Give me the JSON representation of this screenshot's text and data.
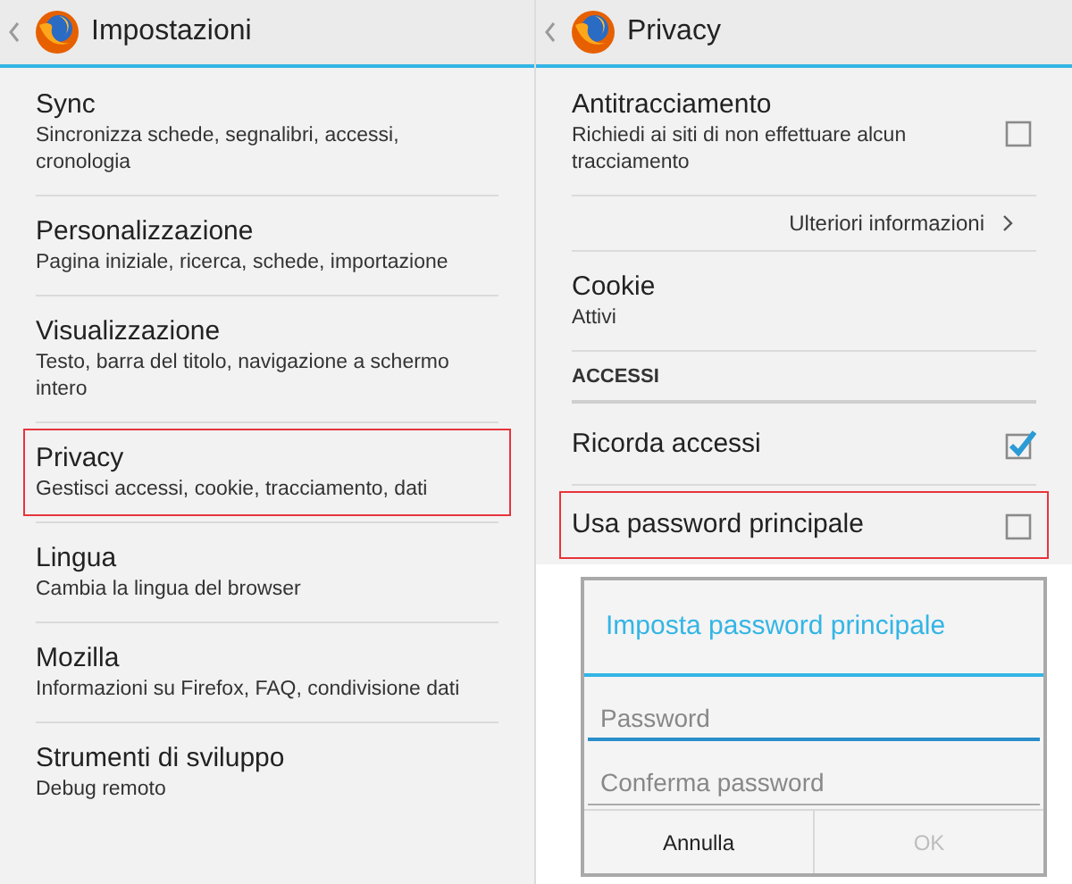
{
  "panels": [
    {
      "title": "Impostazioni",
      "items": [
        {
          "kind": "entry",
          "title": "Sync",
          "subtitle": "Sincronizza schede, segnalibri, accessi, cronologia",
          "highlighted": false
        },
        {
          "kind": "entry",
          "title": "Personalizzazione",
          "subtitle": "Pagina iniziale, ricerca, schede, importazione",
          "highlighted": false
        },
        {
          "kind": "entry",
          "title": "Visualizzazione",
          "subtitle": "Testo, barra del titolo, navigazione a schermo intero",
          "highlighted": false
        },
        {
          "kind": "entry",
          "title": "Privacy",
          "subtitle": "Gestisci accessi, cookie, tracciamento, dati",
          "highlighted": true
        },
        {
          "kind": "entry",
          "title": "Lingua",
          "subtitle": "Cambia la lingua del browser",
          "highlighted": false
        },
        {
          "kind": "entry",
          "title": "Mozilla",
          "subtitle": "Informazioni su Firefox, FAQ, condivisione dati",
          "highlighted": false
        },
        {
          "kind": "entry",
          "title": "Strumenti di sviluppo",
          "subtitle": "Debug remoto",
          "highlighted": false
        }
      ]
    },
    {
      "title": "Privacy",
      "items": [
        {
          "kind": "check",
          "title": "Antitracciamento",
          "subtitle": "Richiedi ai siti di non effettuare alcun tracciamento",
          "checked": false,
          "highlighted": false
        },
        {
          "kind": "link",
          "label": "Ulteriori informazioni"
        },
        {
          "kind": "entry",
          "title": "Cookie",
          "subtitle": "Attivi",
          "highlighted": false
        },
        {
          "kind": "header",
          "label": "ACCESSI"
        },
        {
          "kind": "check",
          "title": "Ricorda accessi",
          "checked": true,
          "highlighted": false
        },
        {
          "kind": "check",
          "title": "Usa password principale",
          "checked": false,
          "highlighted": true
        }
      ]
    }
  ],
  "dialog": {
    "title": "Imposta password principale",
    "fields": [
      {
        "placeholder": "Password",
        "focused": true
      },
      {
        "placeholder": "Conferma password",
        "focused": false
      }
    ],
    "buttons": [
      {
        "label": "Annulla",
        "disabled": false
      },
      {
        "label": "OK",
        "disabled": true
      }
    ]
  }
}
